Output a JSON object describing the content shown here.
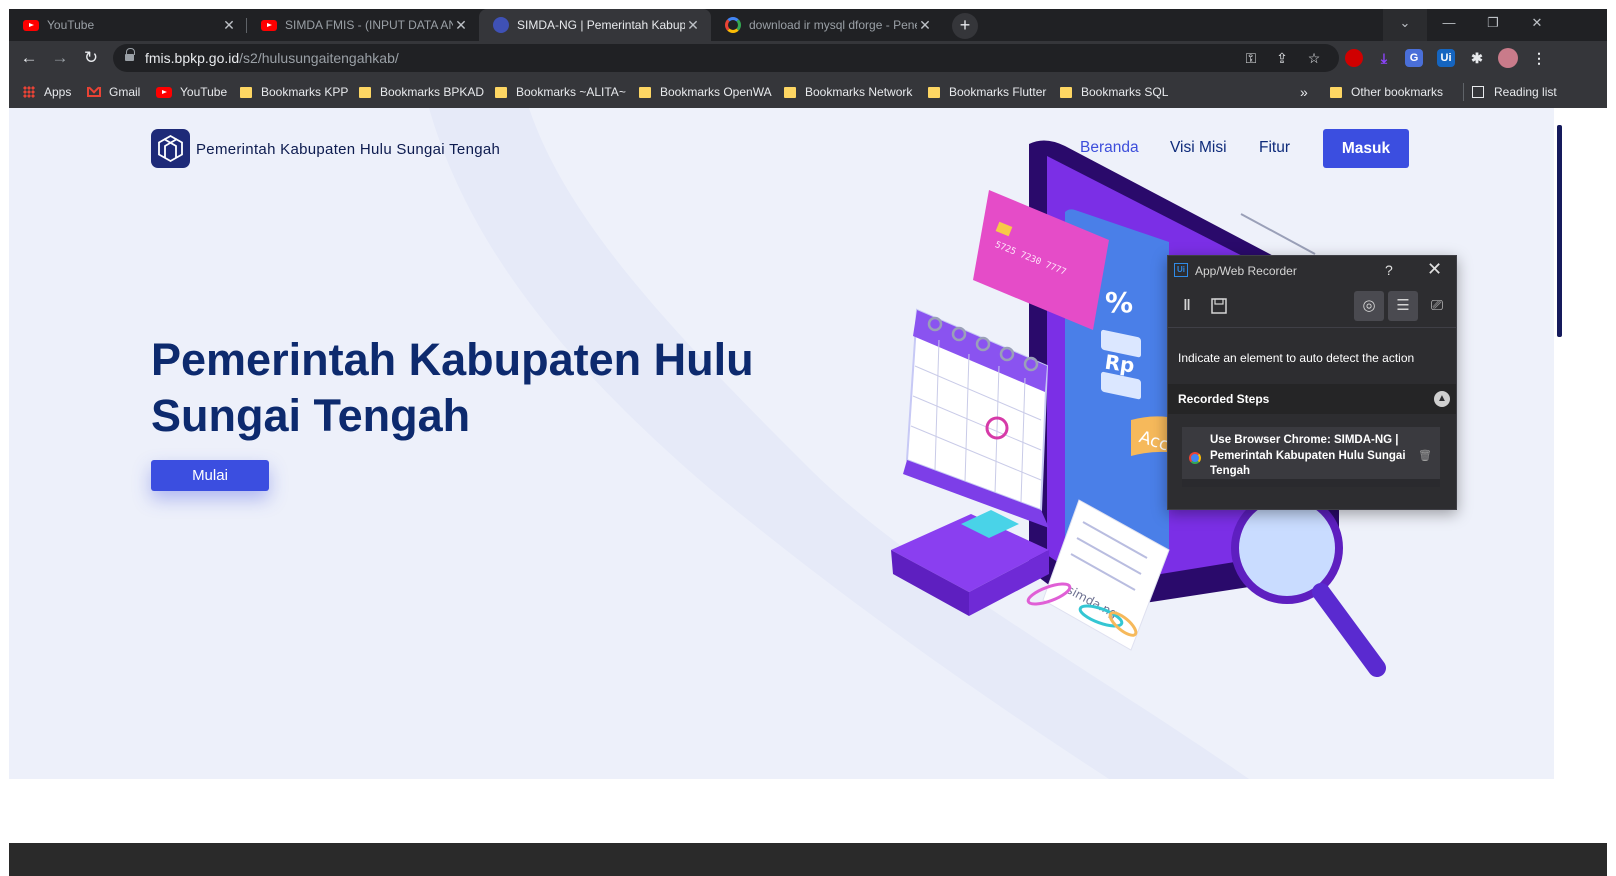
{
  "browser": {
    "tabs": [
      {
        "title": "YouTube",
        "favicon": "youtube-icon",
        "active": false
      },
      {
        "title": "SIMDA FMIS - (INPUT DATA ANG",
        "favicon": "youtube-icon",
        "active": false
      },
      {
        "title": "SIMDA-NG | Pemerintah Kabupat",
        "favicon": "simda-icon",
        "active": true
      },
      {
        "title": "download ir mysql dforge - Pene",
        "favicon": "google-icon",
        "active": false
      }
    ],
    "new_tab_glyph": "+",
    "window_controls": {
      "tab_search": "⌄",
      "minimize": "—",
      "restore": "❐",
      "close": "✕"
    },
    "url_host": "fmis.bpkp.go.id",
    "url_path": "/s2/hulusungaitengahkab/",
    "bookmarks": [
      {
        "label": "Apps",
        "icon": "apps-icon"
      },
      {
        "label": "Gmail",
        "icon": "gmail-icon"
      },
      {
        "label": "YouTube",
        "icon": "youtube-icon"
      },
      {
        "label": "Bookmarks KPP",
        "icon": "folder-icon"
      },
      {
        "label": "Bookmarks BPKAD",
        "icon": "folder-icon"
      },
      {
        "label": "Bookmarks ~ALITA~",
        "icon": "folder-icon"
      },
      {
        "label": "Bookmarks OpenWA",
        "icon": "folder-icon"
      },
      {
        "label": "Bookmarks Network",
        "icon": "folder-icon"
      },
      {
        "label": "Bookmarks Flutter",
        "icon": "folder-icon"
      },
      {
        "label": "Bookmarks SQL",
        "icon": "folder-icon"
      }
    ],
    "bookmarks_overflow": "»",
    "other_bookmarks": "Other bookmarks",
    "reading_list": "Reading list"
  },
  "site": {
    "brand": "Pemerintah Kabupaten Hulu Sungai Tengah",
    "nav": [
      {
        "label": "Beranda",
        "active": true
      },
      {
        "label": "Visi Misi",
        "active": false
      },
      {
        "label": "Fitur",
        "active": false
      }
    ],
    "login_label": "Masuk",
    "hero_title": "Pemerintah Kabupaten Hulu Sungai Tengah",
    "hero_button": "Mulai",
    "illustration": {
      "card_number": "5725 7230 7777",
      "symbols": [
        "%",
        "Rp"
      ],
      "receipt_text": "simda.ng",
      "badge_text": "Acco"
    },
    "accent_color": "#3b4ee0",
    "heading_color": "#0d2a6e"
  },
  "recorder": {
    "title": "App/Web Recorder",
    "help_glyph": "?",
    "close_glyph": "✕",
    "hint": "Indicate an element to auto detect the action",
    "steps_header": "Recorded Steps",
    "steps": [
      {
        "text": "Use Browser Chrome: SIMDA-NG | Pemerintah Kabupaten Hulu Sungai Tengah"
      }
    ]
  }
}
